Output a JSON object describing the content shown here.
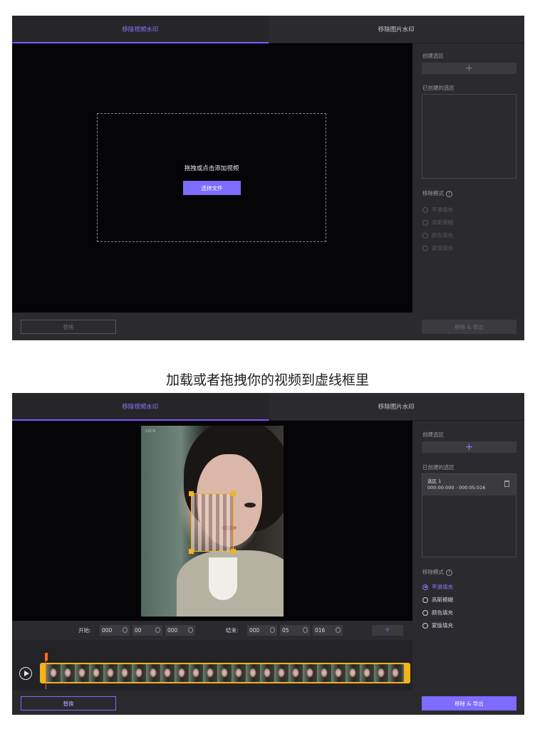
{
  "tabs": {
    "video": "移除视频水印",
    "image": "移除图片水印"
  },
  "drop": {
    "prompt": "拖拽或点击添加视频",
    "select_button": "选择文件"
  },
  "side": {
    "create_region": "创建选区",
    "add_icon": "+",
    "created_regions": "已创建的选区",
    "removal_mode": "移除模式",
    "help_icon": "?",
    "modes": [
      "平滑填充",
      "高斯模糊",
      "颜色填充",
      "蒙版填充"
    ],
    "selected_mode": "平滑填充",
    "region": {
      "name": "选区 1",
      "time": "000:00:000 - 000:05:016"
    }
  },
  "buttons": {
    "replace": "替换",
    "export": "移除 & 导出"
  },
  "caption": "加载或者拖拽你的视频到虚线框里",
  "time": {
    "start_label": "开始:",
    "end_label": "结束:",
    "start": [
      "000",
      "00",
      "000"
    ],
    "end": [
      "000",
      "05",
      "016"
    ]
  },
  "video_tag": "小红书",
  "timeline": {
    "thumb_count": 25
  },
  "colors": {
    "accent": "#7c6cff",
    "selection": "#f2b31b",
    "playhead": "#ff6a1a"
  }
}
